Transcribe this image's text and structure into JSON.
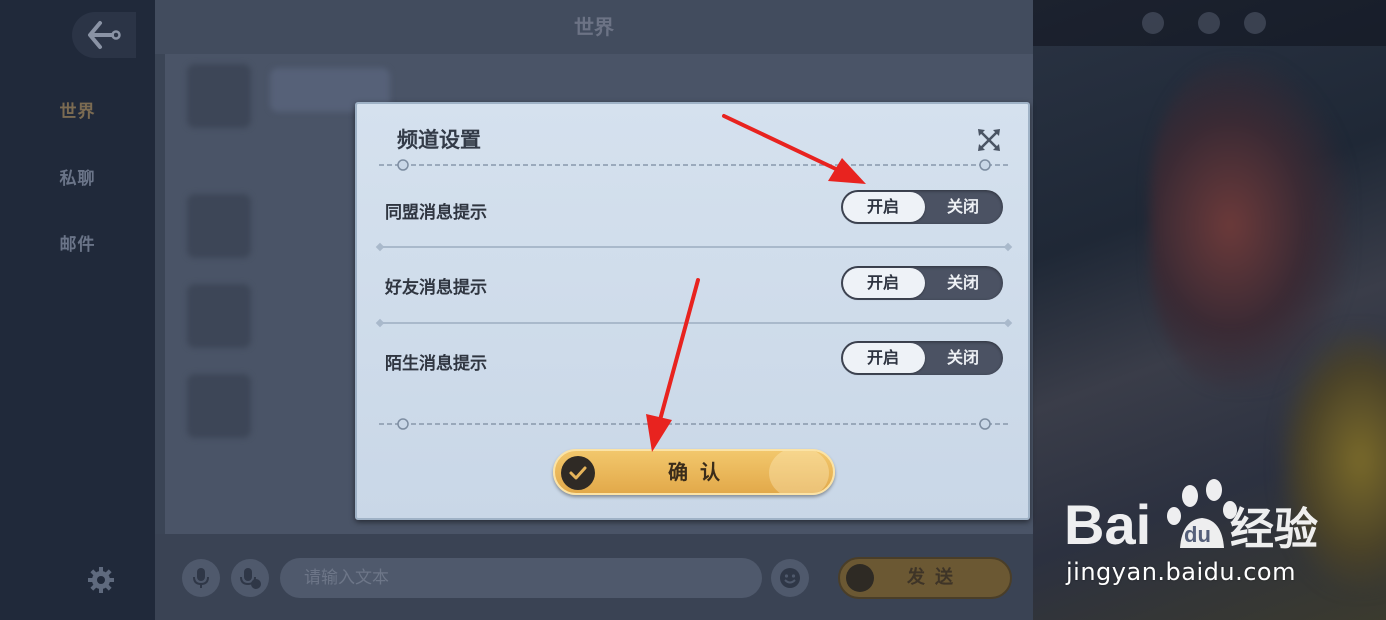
{
  "nav": {
    "items": [
      {
        "label": "世界"
      },
      {
        "label": "私聊"
      },
      {
        "label": "邮件"
      }
    ]
  },
  "chat": {
    "title": "世界",
    "input_placeholder": "请输入文本",
    "send_label": "发送"
  },
  "modal": {
    "title": "频道设置",
    "rows": [
      {
        "label": "同盟消息提示",
        "on_label": "开启",
        "off_label": "关闭",
        "selected": "开启"
      },
      {
        "label": "好友消息提示",
        "on_label": "开启",
        "off_label": "关闭",
        "selected": "开启"
      },
      {
        "label": "陌生消息提示",
        "on_label": "开启",
        "off_label": "关闭",
        "selected": "开启"
      }
    ],
    "confirm_label": "确认"
  },
  "watermark": {
    "brand": "Bai du 经验",
    "url": "jingyan.baidu.com"
  },
  "colors": {
    "accent_gold": "#e8b45a",
    "annotation_red": "#e8231f",
    "modal_bg": "#d0dcea"
  }
}
